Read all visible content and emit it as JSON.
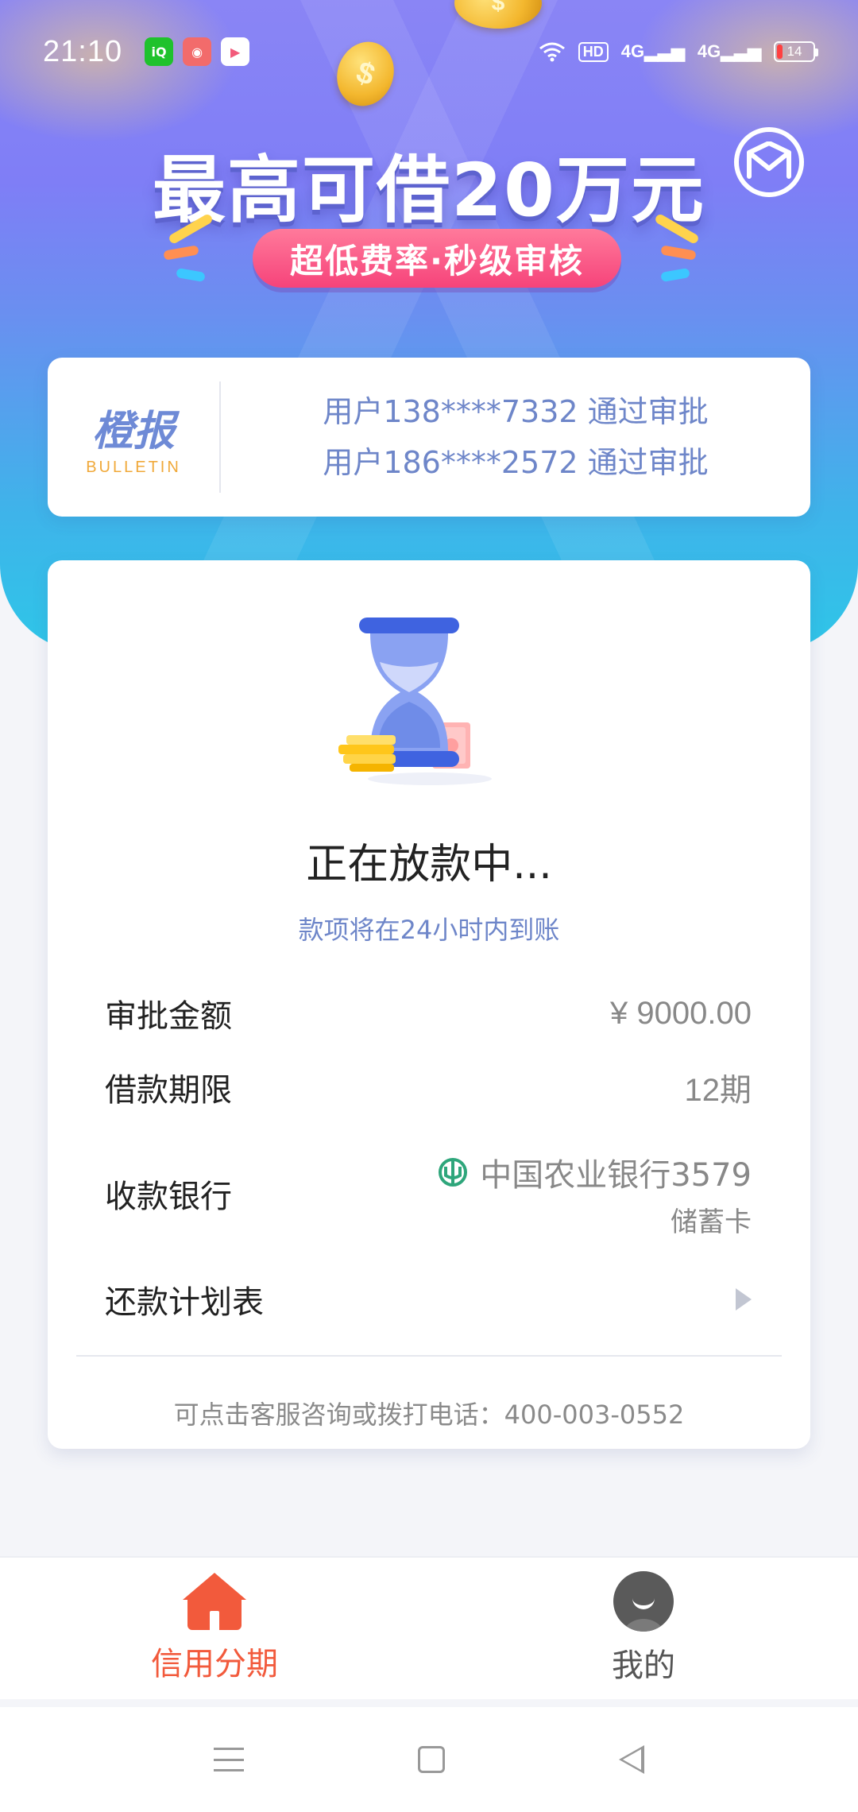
{
  "status_bar": {
    "time": "21:10",
    "app_icons": [
      "iqiyi-icon",
      "doll-machine-icon",
      "video-play-icon"
    ],
    "network_left": "4G",
    "network_right": "4G",
    "hd_label": "HD",
    "battery_level": "14"
  },
  "hero": {
    "headline": "最高可借20万元",
    "subline": "超低费率·秒级审核",
    "coin_symbol": "$"
  },
  "bulletin": {
    "logo_cn": "橙报",
    "logo_en": "BULLETIN",
    "lines": [
      "用户138****7332 通过审批",
      "用户186****2572 通过审批"
    ]
  },
  "loan_status": {
    "title": "正在放款中...",
    "subtitle": "款项将在24小时内到账",
    "rows": [
      {
        "label": "审批金额",
        "value": "¥ 9000.00"
      },
      {
        "label": "借款期限",
        "value": "12期"
      },
      {
        "label": "收款银行",
        "bank": "中国农业银行3579",
        "card_type": "储蓄卡"
      },
      {
        "label": "还款计划表"
      }
    ],
    "footer": "可点击客服咨询或拨打电话：400-003-0552"
  },
  "tabs": [
    {
      "label": "信用分期",
      "icon": "home-icon",
      "active": true
    },
    {
      "label": "我的",
      "icon": "profile-icon",
      "active": false
    }
  ],
  "colors": {
    "accent": "#f25a3c",
    "link_blue": "#6e86c9",
    "pill_pink": "#f6437a"
  }
}
